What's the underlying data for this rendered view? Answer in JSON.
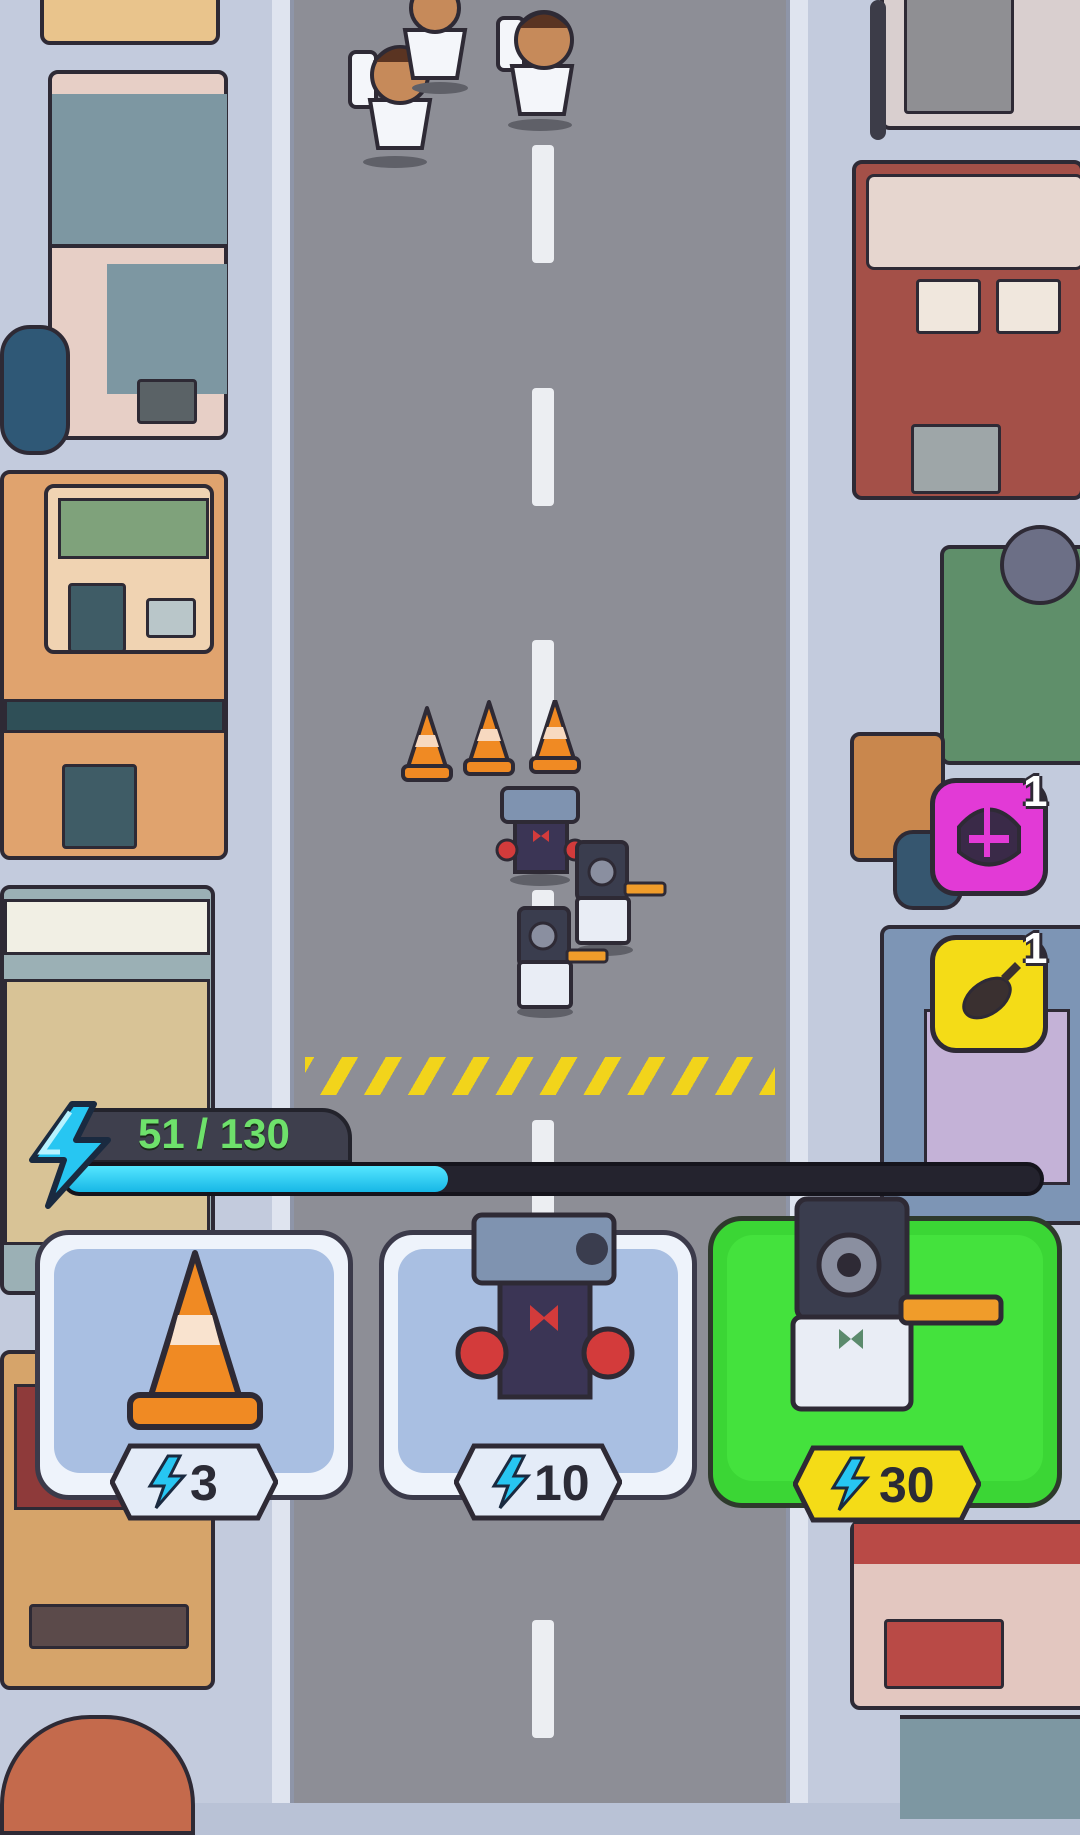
{
  "energy": {
    "current": 51,
    "max": 130,
    "label": "51 / 130",
    "fraction": 0.3923
  },
  "powerups": [
    {
      "name": "shield-helmet",
      "count": "1",
      "color": "#e23ad6"
    },
    {
      "name": "airstrike-bomb",
      "count": "1",
      "color": "#f4dc17"
    }
  ],
  "cards": [
    {
      "name": "traffic-cone",
      "cost": "3",
      "selected": false
    },
    {
      "name": "tv-man-boxer",
      "cost": "10",
      "selected": false
    },
    {
      "name": "speaker-man-gunner",
      "cost": "30",
      "selected": true
    }
  ],
  "colors": {
    "accent": "#17b7e6",
    "selected_card": "#3bd635",
    "energy_text": "#6ee16b",
    "hazard": "#f2d41b"
  }
}
